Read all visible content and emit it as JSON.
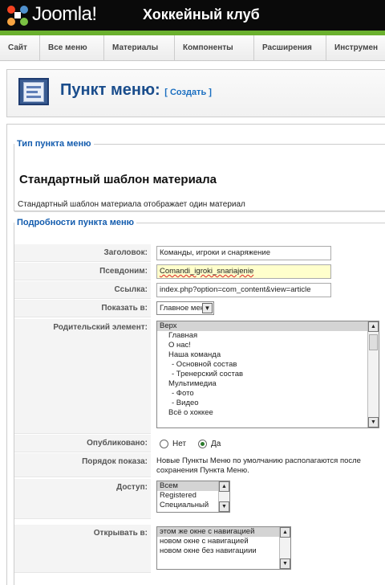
{
  "header": {
    "brand": "Joomla!",
    "site_name": "Хоккейный клуб"
  },
  "menu": [
    "Сайт",
    "Все меню",
    "Материалы",
    "Компоненты",
    "Расширения",
    "Инструмен"
  ],
  "toolbar": {
    "title": "Пункт меню:",
    "subtitle": "[ Создать ]"
  },
  "menu_type": {
    "legend": "Тип пункта меню",
    "title": "Стандартный шаблон материала",
    "description": "Стандартный шаблон материала отображает один материал"
  },
  "details": {
    "legend": "Подробности пункта меню",
    "title_label": "Заголовок:",
    "title_value": "Команды, игроки и снаряжение",
    "alias_label": "Псевдоним:",
    "alias_value": "Comandi_igroki_snariajenie",
    "link_label": "Ссылка:",
    "link_value": "index.php?option=com_content&view=article",
    "show_in_label": "Показать в:",
    "show_in_value": "Главное меню",
    "parent_label": "Родительский элемент:",
    "parent_options": [
      "Верх",
      "Главная",
      "О нас!",
      "Наша команда",
      "- Основной состав",
      "- Тренерский состав",
      "Мультимедиа",
      "- Фото",
      "- Видео",
      "Всё о хоккее"
    ],
    "published_label": "Опубликовано:",
    "published_no": "Нет",
    "published_yes": "Да",
    "order_label": "Порядок показа:",
    "order_note_1": "Новые Пункты Меню по умолчанию располагаются после",
    "order_note_2": "сохранения Пункта Меню.",
    "access_label": "Доступ:",
    "access_options": [
      "Всем",
      "Registered",
      "Специальный"
    ],
    "open_label": "Открывать в:",
    "open_options": [
      "этом же окне с навигацией",
      "новом окне с навигацией",
      "новом окне без навигациии"
    ]
  }
}
